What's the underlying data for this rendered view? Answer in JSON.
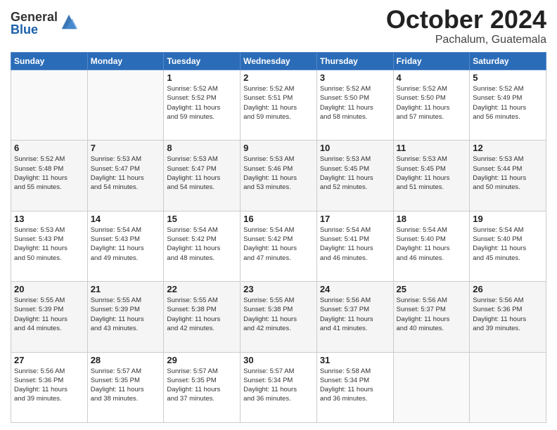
{
  "logo": {
    "general": "General",
    "blue": "Blue"
  },
  "header": {
    "month": "October 2024",
    "location": "Pachalum, Guatemala"
  },
  "weekdays": [
    "Sunday",
    "Monday",
    "Tuesday",
    "Wednesday",
    "Thursday",
    "Friday",
    "Saturday"
  ],
  "days": [
    {
      "date": 0,
      "info": ""
    },
    {
      "date": 0,
      "info": ""
    },
    {
      "date": 1,
      "info": "Sunrise: 5:52 AM\nSunset: 5:52 PM\nDaylight: 11 hours\nand 59 minutes."
    },
    {
      "date": 2,
      "info": "Sunrise: 5:52 AM\nSunset: 5:51 PM\nDaylight: 11 hours\nand 59 minutes."
    },
    {
      "date": 3,
      "info": "Sunrise: 5:52 AM\nSunset: 5:50 PM\nDaylight: 11 hours\nand 58 minutes."
    },
    {
      "date": 4,
      "info": "Sunrise: 5:52 AM\nSunset: 5:50 PM\nDaylight: 11 hours\nand 57 minutes."
    },
    {
      "date": 5,
      "info": "Sunrise: 5:52 AM\nSunset: 5:49 PM\nDaylight: 11 hours\nand 56 minutes."
    },
    {
      "date": 6,
      "info": "Sunrise: 5:52 AM\nSunset: 5:48 PM\nDaylight: 11 hours\nand 55 minutes."
    },
    {
      "date": 7,
      "info": "Sunrise: 5:53 AM\nSunset: 5:47 PM\nDaylight: 11 hours\nand 54 minutes."
    },
    {
      "date": 8,
      "info": "Sunrise: 5:53 AM\nSunset: 5:47 PM\nDaylight: 11 hours\nand 54 minutes."
    },
    {
      "date": 9,
      "info": "Sunrise: 5:53 AM\nSunset: 5:46 PM\nDaylight: 11 hours\nand 53 minutes."
    },
    {
      "date": 10,
      "info": "Sunrise: 5:53 AM\nSunset: 5:45 PM\nDaylight: 11 hours\nand 52 minutes."
    },
    {
      "date": 11,
      "info": "Sunrise: 5:53 AM\nSunset: 5:45 PM\nDaylight: 11 hours\nand 51 minutes."
    },
    {
      "date": 12,
      "info": "Sunrise: 5:53 AM\nSunset: 5:44 PM\nDaylight: 11 hours\nand 50 minutes."
    },
    {
      "date": 13,
      "info": "Sunrise: 5:53 AM\nSunset: 5:43 PM\nDaylight: 11 hours\nand 50 minutes."
    },
    {
      "date": 14,
      "info": "Sunrise: 5:54 AM\nSunset: 5:43 PM\nDaylight: 11 hours\nand 49 minutes."
    },
    {
      "date": 15,
      "info": "Sunrise: 5:54 AM\nSunset: 5:42 PM\nDaylight: 11 hours\nand 48 minutes."
    },
    {
      "date": 16,
      "info": "Sunrise: 5:54 AM\nSunset: 5:42 PM\nDaylight: 11 hours\nand 47 minutes."
    },
    {
      "date": 17,
      "info": "Sunrise: 5:54 AM\nSunset: 5:41 PM\nDaylight: 11 hours\nand 46 minutes."
    },
    {
      "date": 18,
      "info": "Sunrise: 5:54 AM\nSunset: 5:40 PM\nDaylight: 11 hours\nand 46 minutes."
    },
    {
      "date": 19,
      "info": "Sunrise: 5:54 AM\nSunset: 5:40 PM\nDaylight: 11 hours\nand 45 minutes."
    },
    {
      "date": 20,
      "info": "Sunrise: 5:55 AM\nSunset: 5:39 PM\nDaylight: 11 hours\nand 44 minutes."
    },
    {
      "date": 21,
      "info": "Sunrise: 5:55 AM\nSunset: 5:39 PM\nDaylight: 11 hours\nand 43 minutes."
    },
    {
      "date": 22,
      "info": "Sunrise: 5:55 AM\nSunset: 5:38 PM\nDaylight: 11 hours\nand 42 minutes."
    },
    {
      "date": 23,
      "info": "Sunrise: 5:55 AM\nSunset: 5:38 PM\nDaylight: 11 hours\nand 42 minutes."
    },
    {
      "date": 24,
      "info": "Sunrise: 5:56 AM\nSunset: 5:37 PM\nDaylight: 11 hours\nand 41 minutes."
    },
    {
      "date": 25,
      "info": "Sunrise: 5:56 AM\nSunset: 5:37 PM\nDaylight: 11 hours\nand 40 minutes."
    },
    {
      "date": 26,
      "info": "Sunrise: 5:56 AM\nSunset: 5:36 PM\nDaylight: 11 hours\nand 39 minutes."
    },
    {
      "date": 27,
      "info": "Sunrise: 5:56 AM\nSunset: 5:36 PM\nDaylight: 11 hours\nand 39 minutes."
    },
    {
      "date": 28,
      "info": "Sunrise: 5:57 AM\nSunset: 5:35 PM\nDaylight: 11 hours\nand 38 minutes."
    },
    {
      "date": 29,
      "info": "Sunrise: 5:57 AM\nSunset: 5:35 PM\nDaylight: 11 hours\nand 37 minutes."
    },
    {
      "date": 30,
      "info": "Sunrise: 5:57 AM\nSunset: 5:34 PM\nDaylight: 11 hours\nand 36 minutes."
    },
    {
      "date": 31,
      "info": "Sunrise: 5:58 AM\nSunset: 5:34 PM\nDaylight: 11 hours\nand 36 minutes."
    },
    {
      "date": 0,
      "info": ""
    },
    {
      "date": 0,
      "info": ""
    },
    {
      "date": 0,
      "info": ""
    },
    {
      "date": 0,
      "info": ""
    },
    {
      "date": 0,
      "info": ""
    }
  ]
}
